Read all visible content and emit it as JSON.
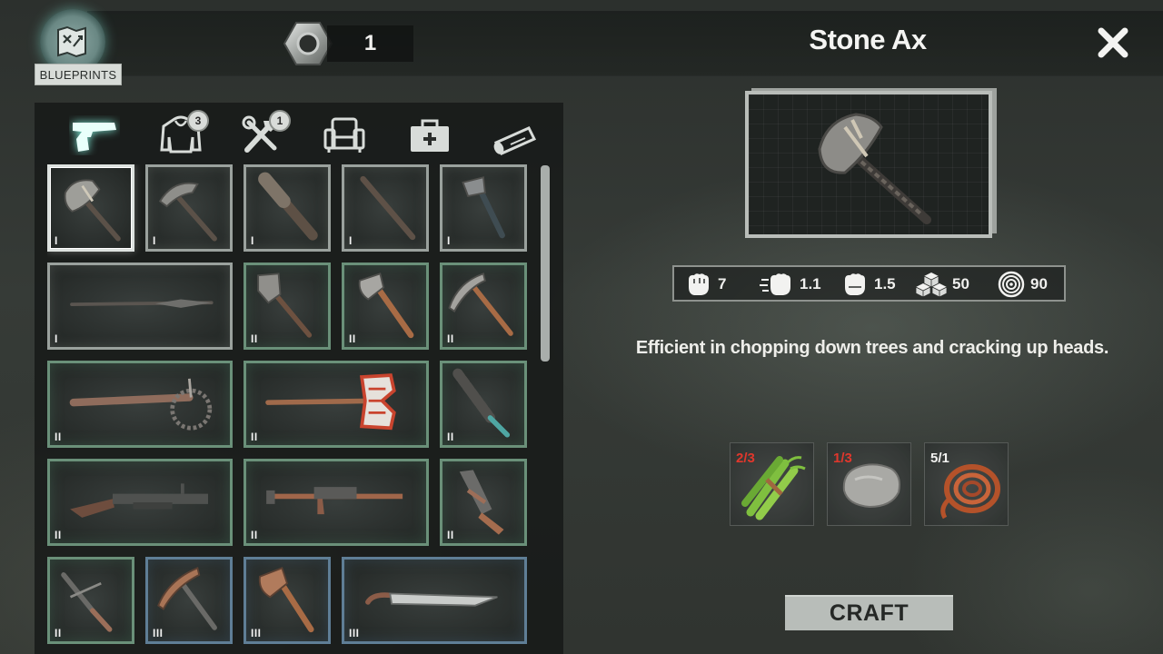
{
  "header": {
    "blueprints_label": "BLUEPRINTS",
    "nut_count": "1",
    "selected_item_title": "Stone Ax"
  },
  "tabs": [
    {
      "name": "weapons",
      "icon": "pistol-icon",
      "active": true,
      "badge": ""
    },
    {
      "name": "clothing",
      "icon": "hoodie-icon",
      "active": false,
      "badge": "3"
    },
    {
      "name": "tools",
      "icon": "tools-icon",
      "active": false,
      "badge": "1"
    },
    {
      "name": "furniture",
      "icon": "armchair-icon",
      "active": false,
      "badge": ""
    },
    {
      "name": "medical",
      "icon": "medkit-icon",
      "active": false,
      "badge": ""
    },
    {
      "name": "scrolls",
      "icon": "scroll-icon",
      "active": false,
      "badge": ""
    }
  ],
  "grid_items": [
    {
      "name": "stone-ax",
      "tier": "I",
      "selected": true
    },
    {
      "name": "stone-pickaxe",
      "tier": "I"
    },
    {
      "name": "wooden-club",
      "tier": "I"
    },
    {
      "name": "wooden-stick",
      "tier": "I"
    },
    {
      "name": "hatchet",
      "tier": "I"
    },
    {
      "name": "spear",
      "tier": "I"
    },
    {
      "name": "shovel",
      "tier": "II"
    },
    {
      "name": "fire-axe",
      "tier": "II"
    },
    {
      "name": "pickaxe",
      "tier": "II"
    },
    {
      "name": "spiked-club",
      "tier": "II"
    },
    {
      "name": "stop-sign-axe",
      "tier": "II"
    },
    {
      "name": "chain-mace",
      "tier": "II"
    },
    {
      "name": "shotgun",
      "tier": "II"
    },
    {
      "name": "pipe-rifle",
      "tier": "II"
    },
    {
      "name": "pipe-pistol",
      "tier": "II"
    },
    {
      "name": "crossbow",
      "tier": "II"
    },
    {
      "name": "steel-pickaxe",
      "tier": "III"
    },
    {
      "name": "steel-axe",
      "tier": "III"
    },
    {
      "name": "machete",
      "tier": "III"
    }
  ],
  "stats": [
    {
      "icon": "fist-damage-icon",
      "value": "7"
    },
    {
      "icon": "fist-speed-icon",
      "value": "1.1"
    },
    {
      "icon": "fist-stamina-icon",
      "value": "1.5"
    },
    {
      "icon": "cubes-durability-icon",
      "value": "50"
    },
    {
      "icon": "target-accuracy-icon",
      "value": "90"
    }
  ],
  "description": "Efficient in chopping down trees and cracking up heads.",
  "materials": [
    {
      "name": "bamboo",
      "count": "2/3",
      "count_color": "#e0372c"
    },
    {
      "name": "stone",
      "count": "1/3",
      "count_color": "#e0372c"
    },
    {
      "name": "rope",
      "count": "5/1",
      "count_color": "#f2f2f0"
    }
  ],
  "craft_label": "CRAFT"
}
